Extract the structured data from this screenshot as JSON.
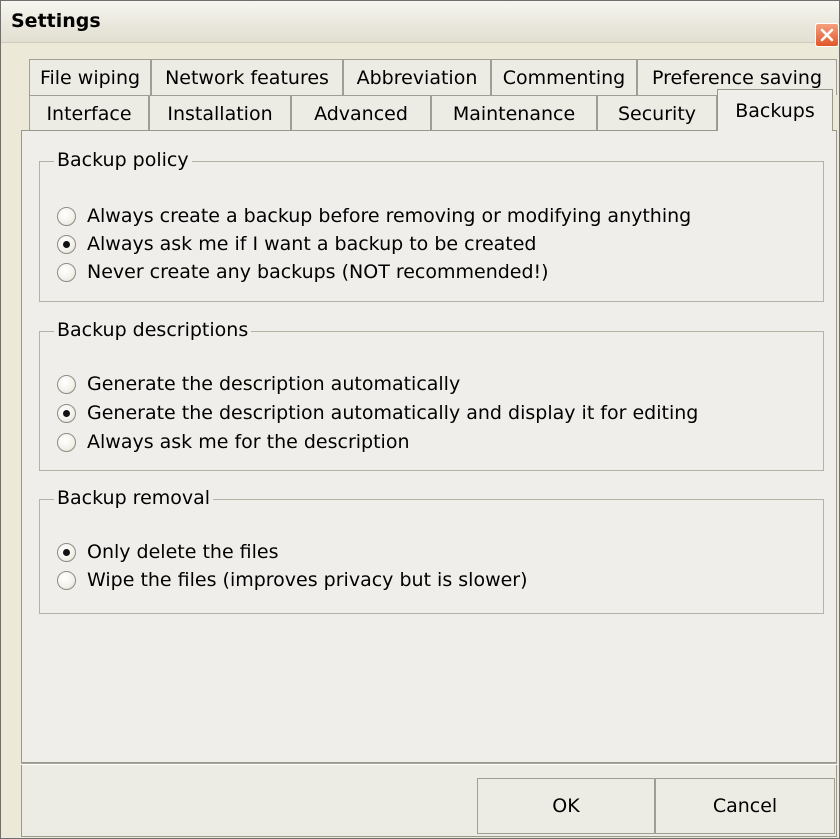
{
  "window": {
    "title": "Settings"
  },
  "tabs": {
    "row1": [
      "File wiping",
      "Network features",
      "Abbreviation",
      "Commenting",
      "Preference saving"
    ],
    "row2": [
      "Interface",
      "Installation",
      "Advanced",
      "Maintenance",
      "Security",
      "Backups"
    ],
    "active": "Backups"
  },
  "backup_policy": {
    "title": "Backup policy",
    "options": [
      "Always create a backup before removing or modifying anything",
      "Always ask me if I want a backup to be created",
      "Never create any backups (NOT recommended!)"
    ],
    "selected_index": 1
  },
  "backup_descriptions": {
    "title": "Backup descriptions",
    "options": [
      "Generate the description automatically",
      "Generate the description automatically and display it for editing",
      "Always ask me for the description"
    ],
    "selected_index": 1
  },
  "backup_removal": {
    "title": "Backup removal",
    "options": [
      "Only delete the files",
      "Wipe the files (improves privacy but is slower)"
    ],
    "selected_index": 0
  },
  "buttons": {
    "ok": "OK",
    "cancel": "Cancel"
  },
  "colors": {
    "dialog_bg": "#ece9d8",
    "panel_bg": "#efeeea",
    "close_button": "#e2562b"
  },
  "icons": {
    "close": "close-icon"
  }
}
